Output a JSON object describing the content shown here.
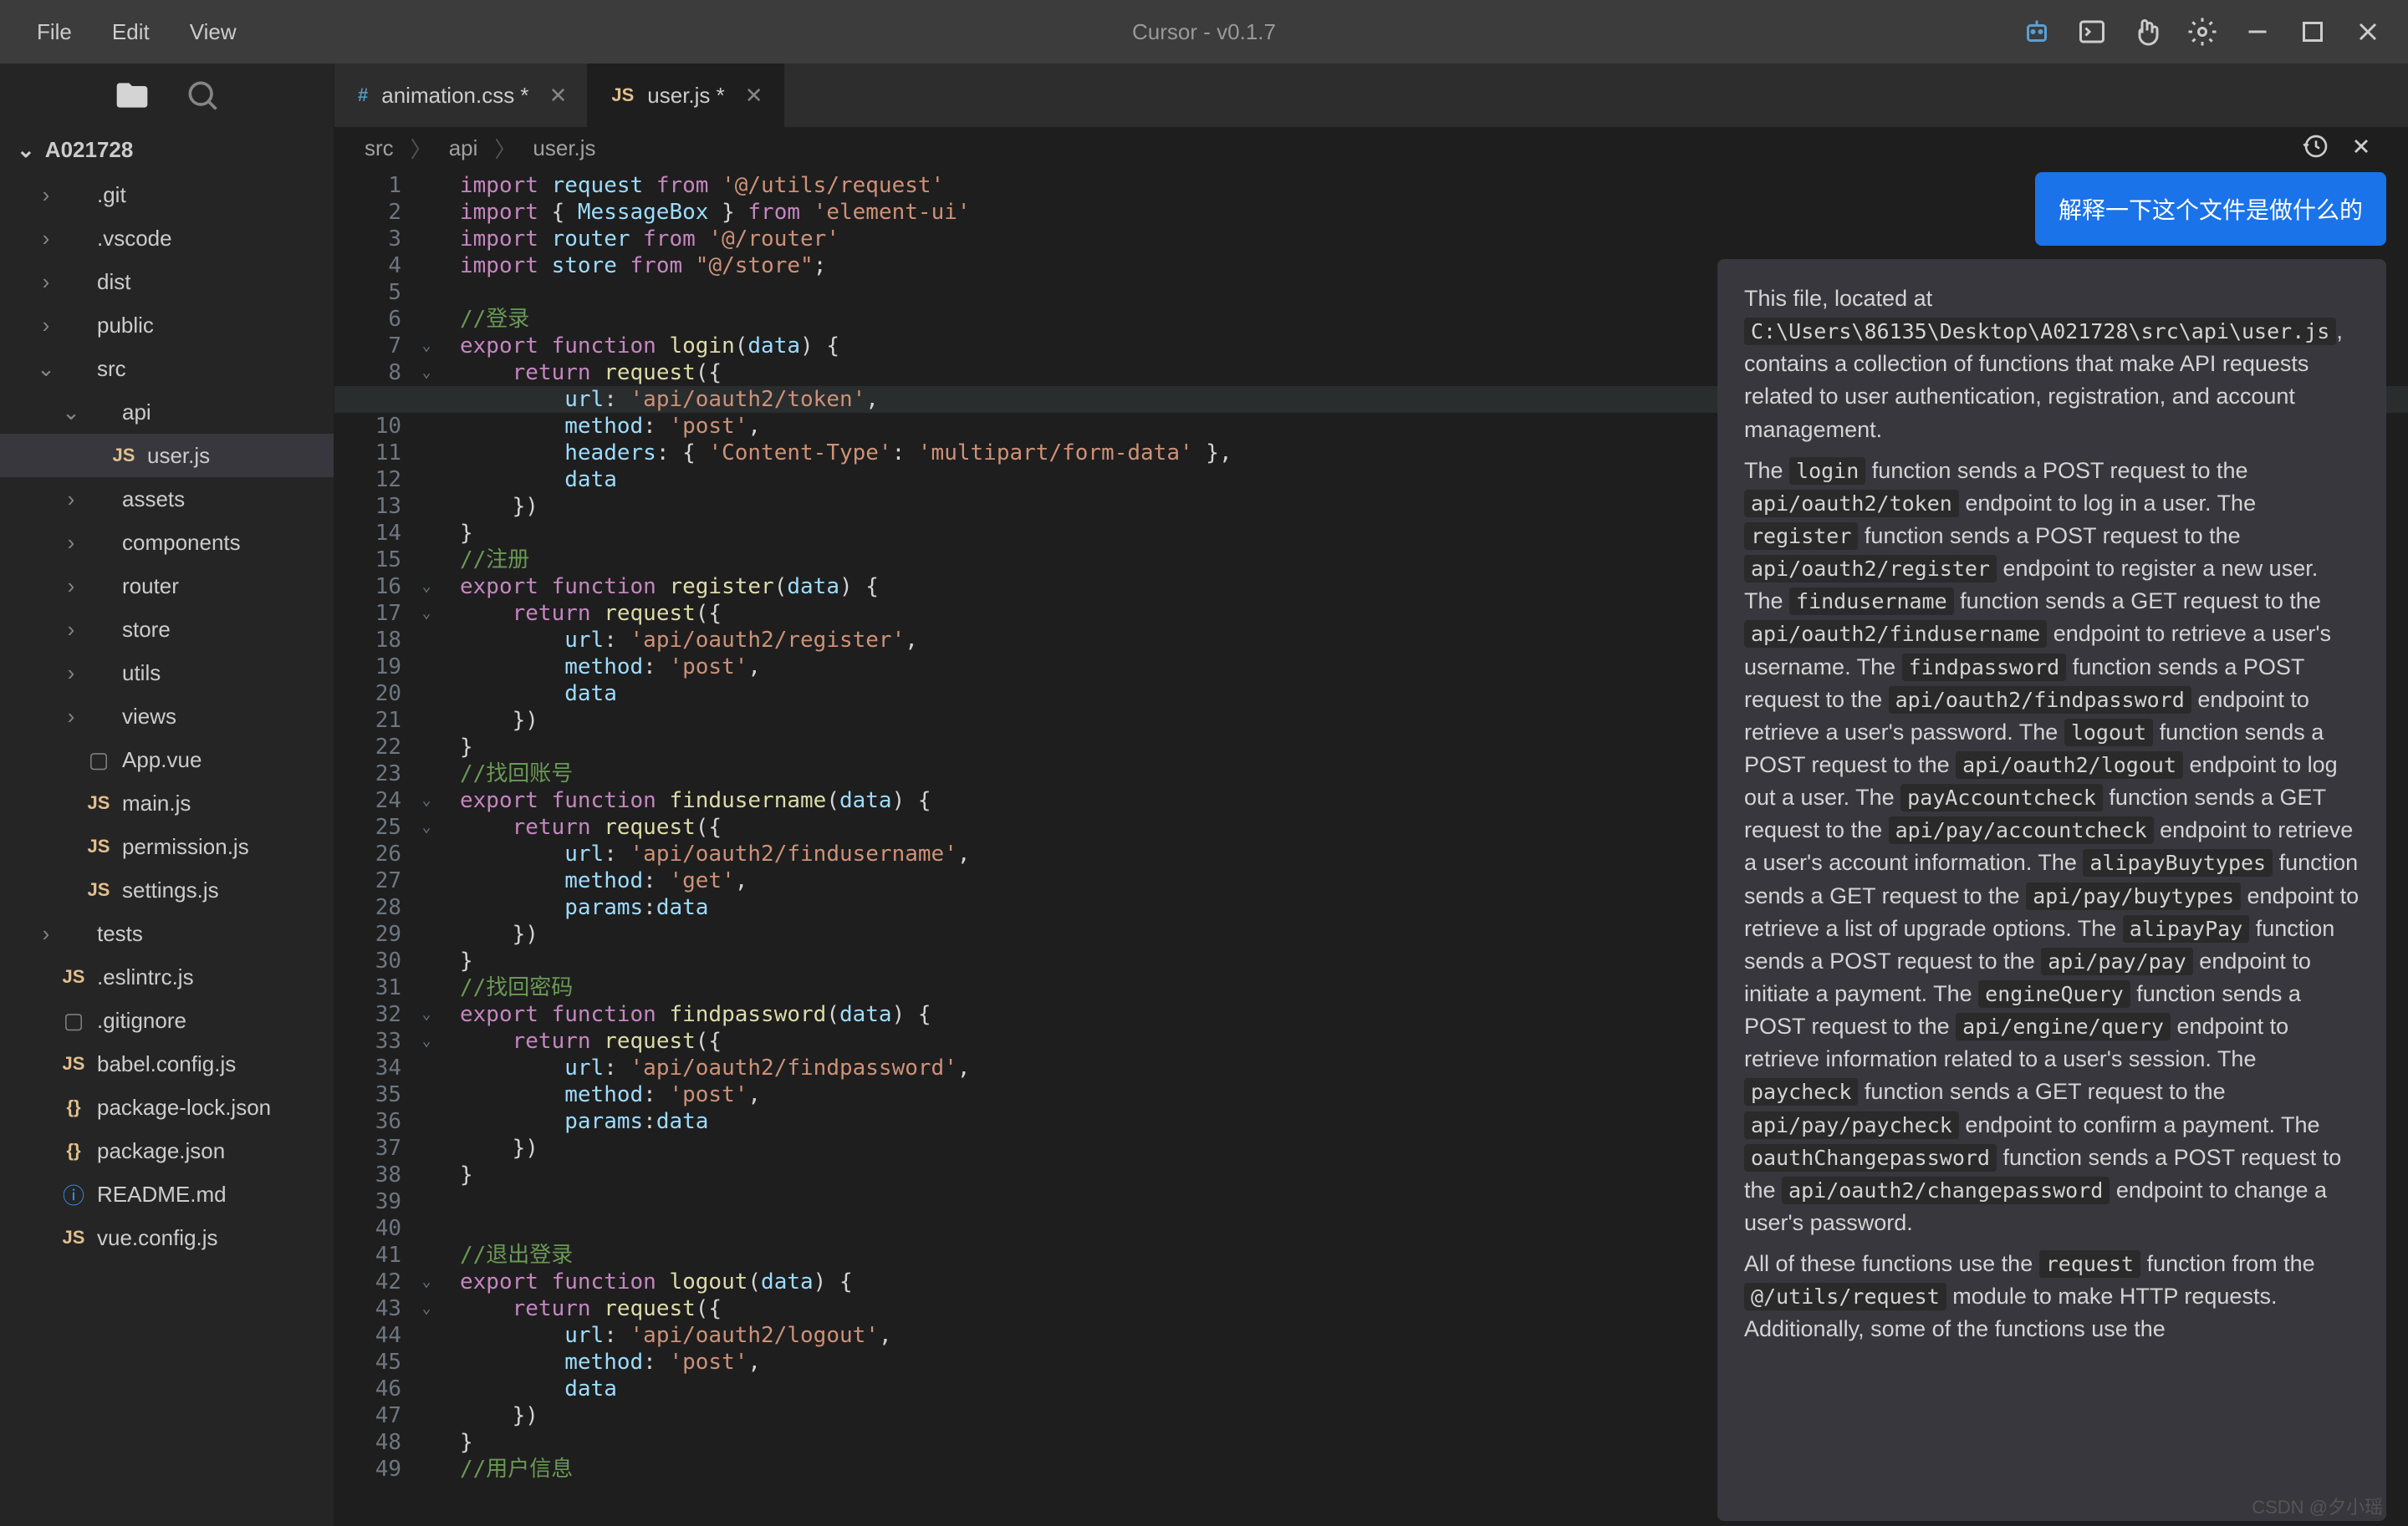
{
  "app": {
    "title": "Cursor - v0.1.7"
  },
  "menu": [
    "File",
    "Edit",
    "View"
  ],
  "project": {
    "name": "A021728"
  },
  "tree": [
    {
      "name": ".git",
      "type": "folder",
      "indent": 0,
      "expanded": false
    },
    {
      "name": ".vscode",
      "type": "folder",
      "indent": 0,
      "expanded": false
    },
    {
      "name": "dist",
      "type": "folder",
      "indent": 0,
      "expanded": false
    },
    {
      "name": "public",
      "type": "folder",
      "indent": 0,
      "expanded": false
    },
    {
      "name": "src",
      "type": "folder",
      "indent": 0,
      "expanded": true
    },
    {
      "name": "api",
      "type": "folder",
      "indent": 1,
      "expanded": true
    },
    {
      "name": "user.js",
      "type": "js",
      "indent": 2,
      "selected": true
    },
    {
      "name": "assets",
      "type": "folder",
      "indent": 1,
      "expanded": false
    },
    {
      "name": "components",
      "type": "folder",
      "indent": 1,
      "expanded": false
    },
    {
      "name": "router",
      "type": "folder",
      "indent": 1,
      "expanded": false
    },
    {
      "name": "store",
      "type": "folder",
      "indent": 1,
      "expanded": false
    },
    {
      "name": "utils",
      "type": "folder",
      "indent": 1,
      "expanded": false
    },
    {
      "name": "views",
      "type": "folder",
      "indent": 1,
      "expanded": false
    },
    {
      "name": "App.vue",
      "type": "file",
      "indent": 1
    },
    {
      "name": "main.js",
      "type": "js",
      "indent": 1
    },
    {
      "name": "permission.js",
      "type": "js",
      "indent": 1
    },
    {
      "name": "settings.js",
      "type": "js",
      "indent": 1
    },
    {
      "name": "tests",
      "type": "folder",
      "indent": 0,
      "expanded": false
    },
    {
      "name": ".eslintrc.js",
      "type": "js",
      "indent": 0
    },
    {
      "name": ".gitignore",
      "type": "file",
      "indent": 0
    },
    {
      "name": "babel.config.js",
      "type": "js",
      "indent": 0
    },
    {
      "name": "package-lock.json",
      "type": "json",
      "indent": 0
    },
    {
      "name": "package.json",
      "type": "json",
      "indent": 0
    },
    {
      "name": "README.md",
      "type": "info",
      "indent": 0
    },
    {
      "name": "vue.config.js",
      "type": "js",
      "indent": 0
    }
  ],
  "tabs": [
    {
      "label": "animation.css *",
      "icon": "#",
      "iconClass": "tab-css",
      "active": false
    },
    {
      "label": "user.js *",
      "icon": "JS",
      "iconClass": "tab-js",
      "active": true
    }
  ],
  "breadcrumb": [
    "src",
    "api",
    "user.js"
  ],
  "code": {
    "lines": 49,
    "highlight": 9,
    "foldable": [
      7,
      8,
      16,
      17,
      24,
      25,
      32,
      33,
      42,
      43
    ]
  },
  "ai": {
    "prompt": "解释一下这个文件是做什么的",
    "response": {
      "intro": "This file, located at ",
      "path": "C:\\Users\\86135\\Desktop\\A021728\\src\\api\\user.js",
      "intro2": ", contains a collection of functions that make API requests related to user authentication, registration, and account management.",
      "body_parts": [
        "The ",
        {
          "c": "login"
        },
        " function sends a POST request to the ",
        {
          "c": "api/oauth2/token"
        },
        " endpoint to log in a user. The ",
        {
          "c": "register"
        },
        " function sends a POST request to the ",
        {
          "c": "api/oauth2/register"
        },
        " endpoint to register a new user. The ",
        {
          "c": "findusername"
        },
        " function sends a GET request to the ",
        {
          "c": "api/oauth2/findusername"
        },
        " endpoint to retrieve a user's username. The ",
        {
          "c": "findpassword"
        },
        " function sends a POST request to the ",
        {
          "c": "api/oauth2/findpassword"
        },
        " endpoint to retrieve a user's password. The ",
        {
          "c": "logout"
        },
        " function sends a POST request to the ",
        {
          "c": "api/oauth2/logout"
        },
        " endpoint to log out a user. The ",
        {
          "c": "payAccountcheck"
        },
        " function sends a GET request to the ",
        {
          "c": "api/pay/accountcheck"
        },
        " endpoint to retrieve a user's account information. The ",
        {
          "c": "alipayBuytypes"
        },
        " function sends a GET request to the ",
        {
          "c": "api/pay/buytypes"
        },
        " endpoint to retrieve a list of upgrade options. The ",
        {
          "c": "alipayPay"
        },
        " function sends a POST request to the ",
        {
          "c": "api/pay/pay"
        },
        " endpoint to initiate a payment. The ",
        {
          "c": "engineQuery"
        },
        " function sends a POST request to the ",
        {
          "c": "api/engine/query"
        },
        " endpoint to retrieve information related to a user's session. The ",
        {
          "c": "paycheck"
        },
        " function sends a GET request to the ",
        {
          "c": "api/pay/paycheck"
        },
        " endpoint to confirm a payment. The ",
        {
          "c": "oauthChangepassword"
        },
        " function sends a POST request to the ",
        {
          "c": "api/oauth2/changepassword"
        },
        " endpoint to change a user's password."
      ],
      "footer_parts": [
        "All of these functions use the ",
        {
          "c": "request"
        },
        " function from the ",
        {
          "c": "@/utils/request"
        },
        " module to make HTTP requests. Additionally, some of the functions use the "
      ]
    }
  },
  "watermark": "CSDN @夕小瑶"
}
